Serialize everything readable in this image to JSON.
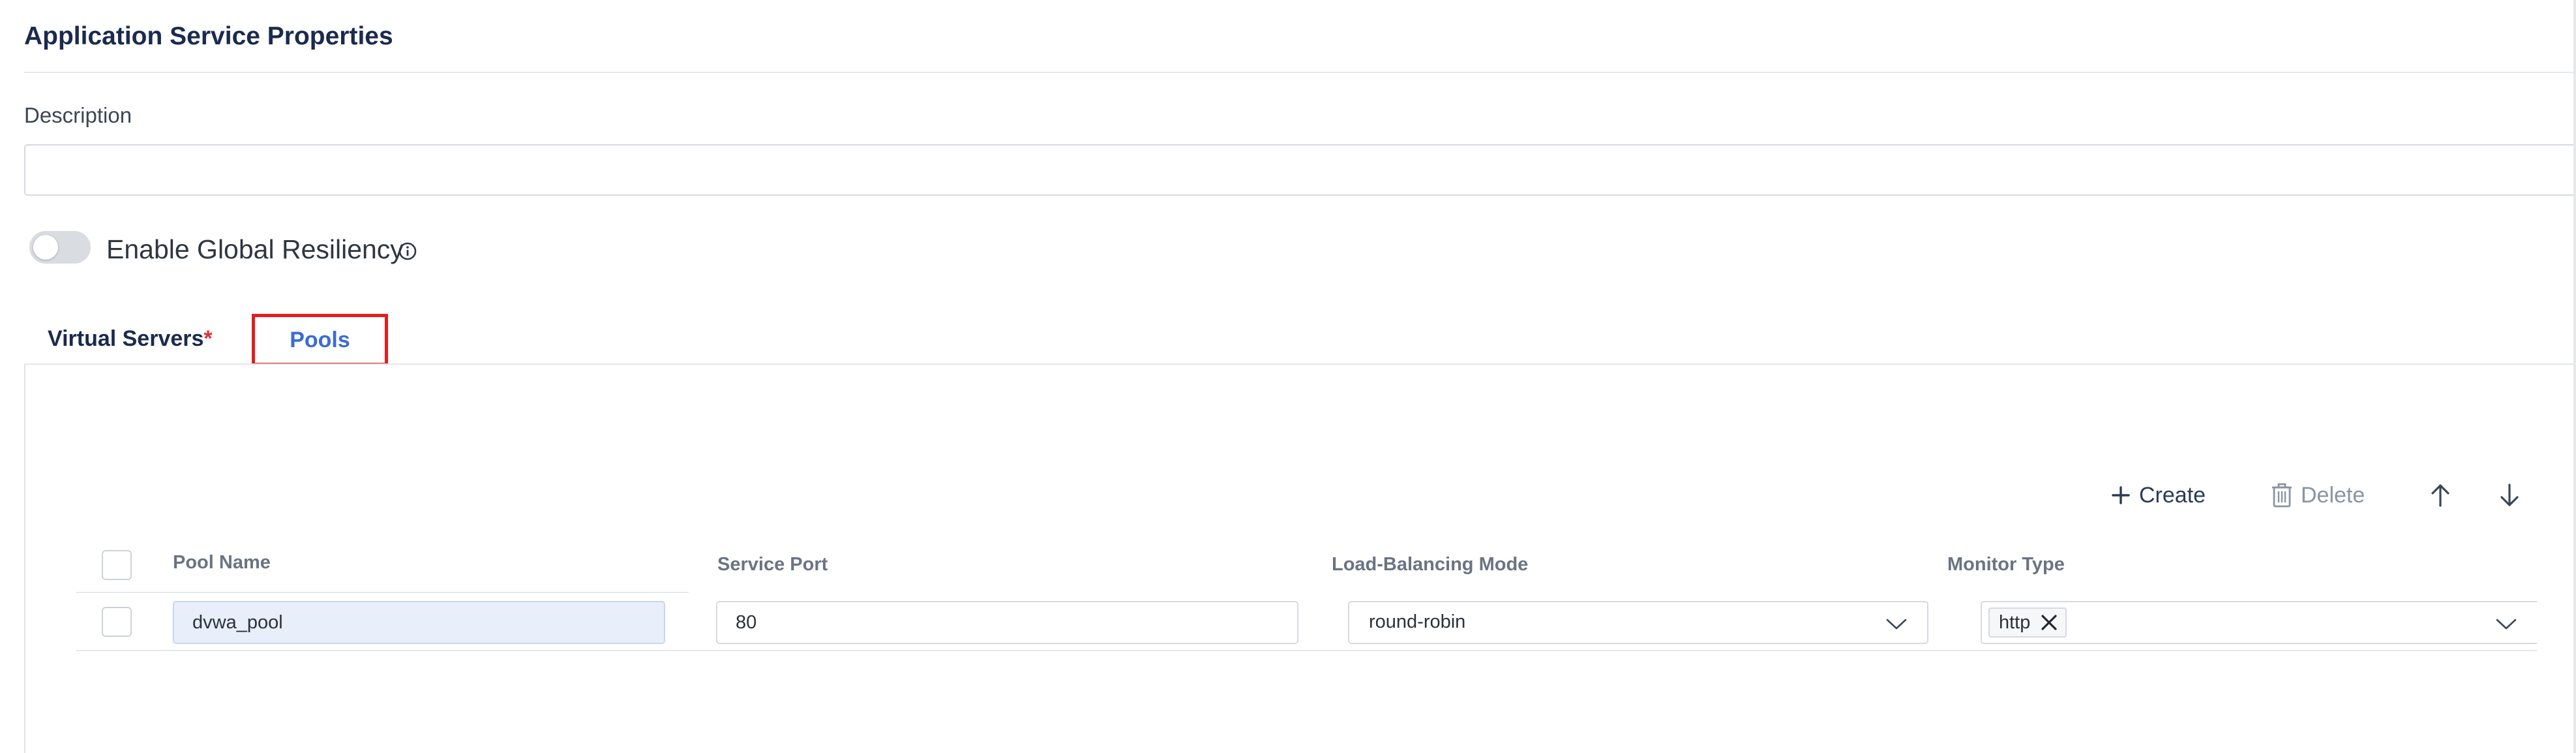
{
  "section": {
    "title": "Application Service Properties"
  },
  "description": {
    "label": "Description",
    "value": "",
    "placeholder": ""
  },
  "global_resiliency": {
    "label": "Enable Global Resiliency",
    "enabled": false
  },
  "tabs": [
    {
      "label": "Virtual Servers",
      "required_mark": "*",
      "active": false
    },
    {
      "label": "Pools",
      "active": true
    }
  ],
  "toolbar": {
    "create_label": "Create",
    "delete_label": "Delete"
  },
  "table": {
    "columns": [
      "Pool Name",
      "Service Port",
      "Load-Balancing Mode",
      "Monitor Type"
    ],
    "rows": [
      {
        "pool_name": "dvwa_pool",
        "service_port": "80",
        "lb_mode": "round-robin",
        "monitor_types": [
          "http"
        ]
      }
    ]
  },
  "colors": {
    "accent": "#3b6bd8",
    "highlight_box": "#e51d1d",
    "title": "#1b2a4e",
    "required": "#e03131"
  },
  "icons": [
    "info-icon",
    "plus-icon",
    "trash-icon",
    "arrow-up-icon",
    "arrow-down-icon",
    "chevron-down-icon",
    "close-icon"
  ]
}
